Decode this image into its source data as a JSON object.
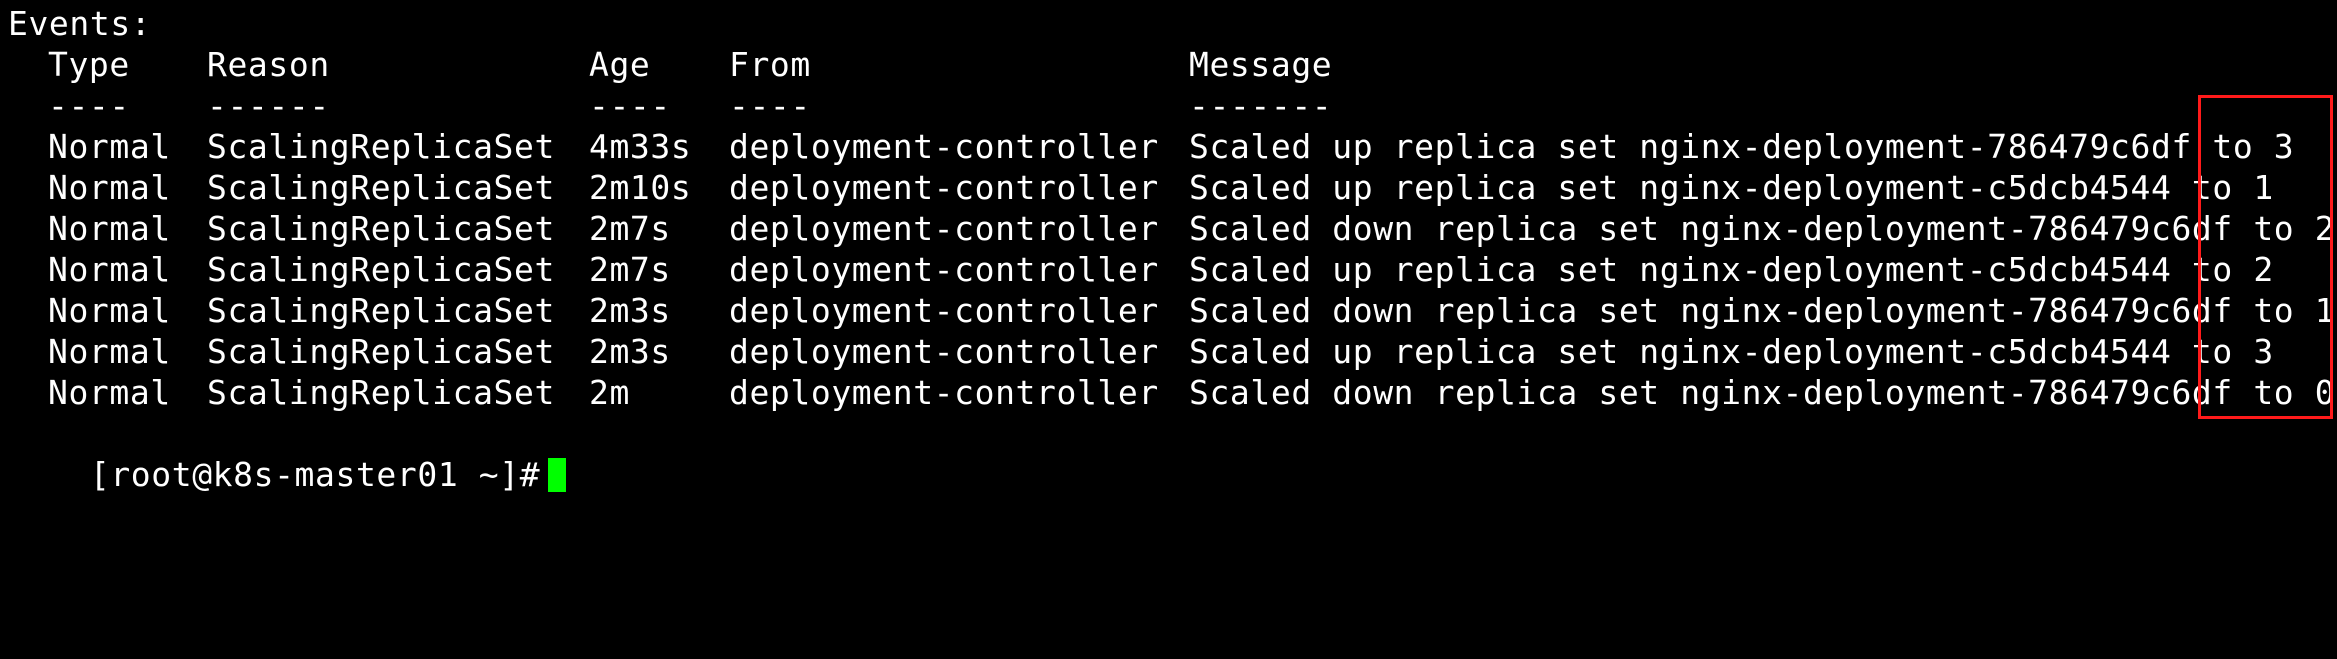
{
  "terminal": {
    "top_clipped_text": "                                                                                  ",
    "events_heading": "Events:",
    "headers": {
      "type": "Type",
      "reason": "Reason",
      "age": "Age",
      "from": "From",
      "message": "Message"
    },
    "separators": {
      "type": "----",
      "reason": "------",
      "age": "----",
      "from": "----",
      "message": "-------"
    },
    "rows": [
      {
        "type": "Normal",
        "reason": "ScalingReplicaSet",
        "age": "4m33s",
        "from": "deployment-controller",
        "message": "Scaled up replica set nginx-deployment-786479c6df to 3"
      },
      {
        "type": "Normal",
        "reason": "ScalingReplicaSet",
        "age": "2m10s",
        "from": "deployment-controller",
        "message": "Scaled up replica set nginx-deployment-c5dcb4544 to 1"
      },
      {
        "type": "Normal",
        "reason": "ScalingReplicaSet",
        "age": "2m7s",
        "from": "deployment-controller",
        "message": "Scaled down replica set nginx-deployment-786479c6df to 2"
      },
      {
        "type": "Normal",
        "reason": "ScalingReplicaSet",
        "age": "2m7s",
        "from": "deployment-controller",
        "message": "Scaled up replica set nginx-deployment-c5dcb4544 to 2"
      },
      {
        "type": "Normal",
        "reason": "ScalingReplicaSet",
        "age": "2m3s",
        "from": "deployment-controller",
        "message": "Scaled down replica set nginx-deployment-786479c6df to 1"
      },
      {
        "type": "Normal",
        "reason": "ScalingReplicaSet",
        "age": "2m3s",
        "from": "deployment-controller",
        "message": "Scaled up replica set nginx-deployment-c5dcb4544 to 3"
      },
      {
        "type": "Normal",
        "reason": "ScalingReplicaSet",
        "age": "2m",
        "from": "deployment-controller",
        "message": "Scaled down replica set nginx-deployment-786479c6df to 0"
      }
    ],
    "prompt": "[root@k8s-master01 ~]#",
    "cursor_color": "#00ff00",
    "annotation_color": "#ff1a1a",
    "text_color": "#ffffff",
    "background_color": "#000000"
  }
}
